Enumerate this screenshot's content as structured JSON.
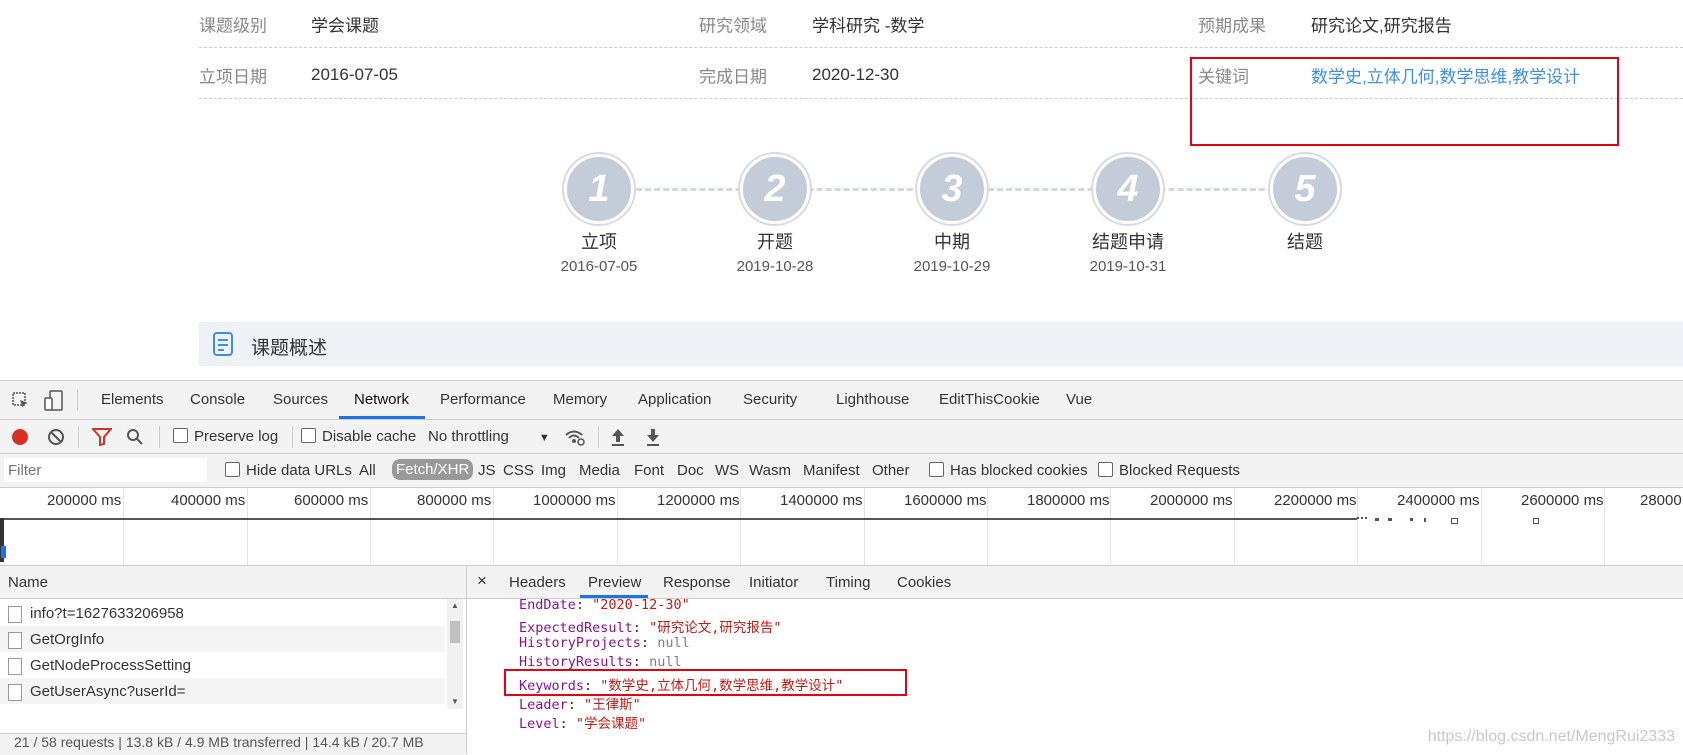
{
  "info_rows": [
    {
      "items": [
        {
          "label": "课题级别",
          "value": "学会课题"
        },
        {
          "label": "研究领域",
          "value": "学科研究 -数学"
        },
        {
          "label": "预期成果",
          "value": "研究论文,研究报告"
        }
      ]
    },
    {
      "items": [
        {
          "label": "立项日期",
          "value": "2016-07-05"
        },
        {
          "label": "完成日期",
          "value": "2020-12-30"
        },
        {
          "label": "关键词",
          "value": "数学史,立体几何,数学思维,教学设计"
        }
      ]
    }
  ],
  "timeline": [
    {
      "num": "1",
      "name": "立项",
      "date": "2016-07-05"
    },
    {
      "num": "2",
      "name": "开题",
      "date": "2019-10-28"
    },
    {
      "num": "3",
      "name": "中期",
      "date": "2019-10-29"
    },
    {
      "num": "4",
      "name": "结题申请",
      "date": "2019-10-31"
    },
    {
      "num": "5",
      "name": "结题",
      "date": ""
    }
  ],
  "overview_title": "课题概述",
  "devtools": {
    "tabs": [
      "Elements",
      "Console",
      "Sources",
      "Network",
      "Performance",
      "Memory",
      "Application",
      "Security",
      "Lighthouse",
      "EditThisCookie",
      "Vue"
    ],
    "active_tab": "Network",
    "toolbar": {
      "preserve_log": "Preserve log",
      "disable_cache": "Disable cache",
      "throttling": "No throttling"
    },
    "filter_placeholder": "Filter",
    "hide_data_urls": "Hide data URLs",
    "filter_types": [
      "All",
      "Fetch/XHR",
      "JS",
      "CSS",
      "Img",
      "Media",
      "Font",
      "Doc",
      "WS",
      "Wasm",
      "Manifest",
      "Other"
    ],
    "active_filter": "Fetch/XHR",
    "has_blocked_cookies": "Has blocked cookies",
    "blocked_requests": "Blocked Requests",
    "ticks": [
      "200000 ms",
      "400000 ms",
      "600000 ms",
      "800000 ms",
      "1000000 ms",
      "1200000 ms",
      "1400000 ms",
      "1600000 ms",
      "1800000 ms",
      "2000000 ms",
      "2200000 ms",
      "2400000 ms",
      "2600000 ms",
      "28000"
    ],
    "name_header": "Name",
    "requests": [
      "info?t=1627633206958",
      "GetOrgInfo",
      "GetNodeProcessSetting",
      "GetUserAsync?userId="
    ],
    "status": "21 / 58 requests  |  13.8 kB / 4.9 MB transferred  |  14.4 kB / 20.7 MB",
    "detail_tabs": [
      "Headers",
      "Preview",
      "Response",
      "Initiator",
      "Timing",
      "Cookies"
    ],
    "active_detail_tab": "Preview",
    "preview": [
      {
        "key": "EndDate",
        "value": "\"2020-12-30\"",
        "type": "str"
      },
      {
        "key": "ExpectedResult",
        "value": "\"研究论文,研究报告\"",
        "type": "str"
      },
      {
        "key": "HistoryProjects",
        "value": "null",
        "type": "nul"
      },
      {
        "key": "HistoryResults",
        "value": "null",
        "type": "nul"
      },
      {
        "key": "Keywords",
        "value": "\"数学史,立体几何,数学思维,教学设计\"",
        "type": "str"
      },
      {
        "key": "Leader",
        "value": "\"王律斯\"",
        "type": "str"
      },
      {
        "key": "Level",
        "value": "\"学会课题\"",
        "type": "str"
      }
    ]
  },
  "watermark": "https://blog.csdn.net/MengRui2333"
}
